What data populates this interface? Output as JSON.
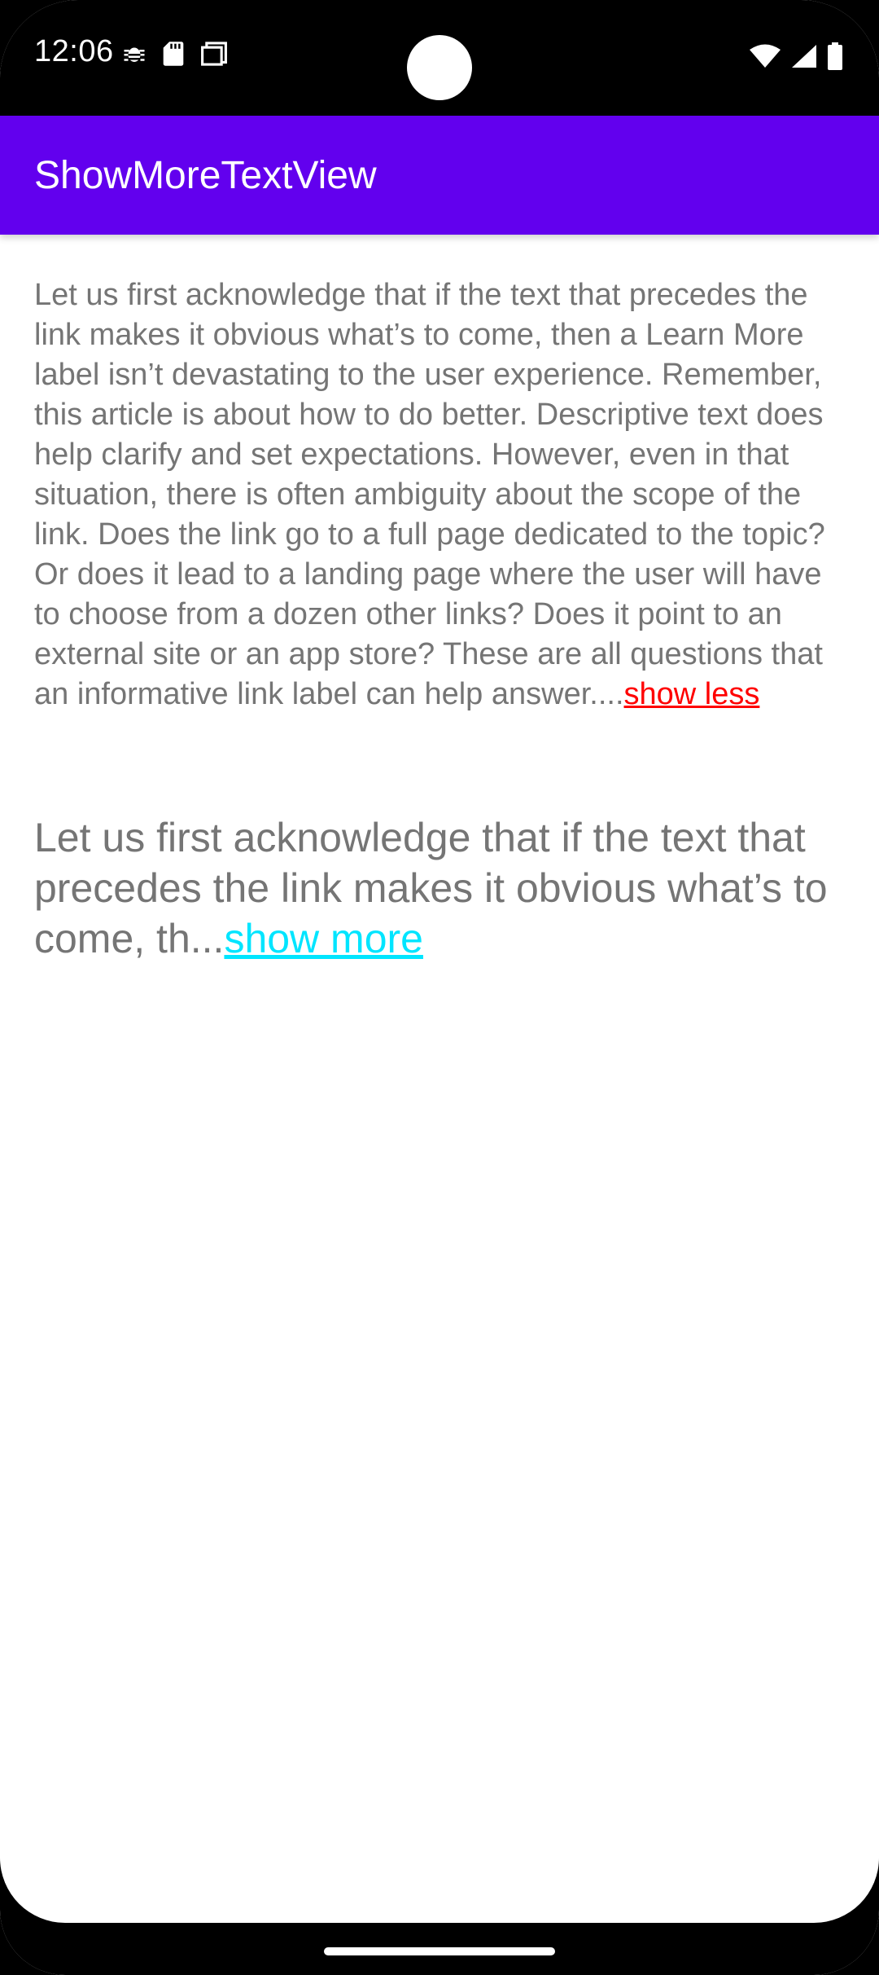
{
  "status_bar": {
    "time": "12:06",
    "left_icons": [
      "bug-icon",
      "sd-card-icon",
      "screenshot-icon"
    ],
    "right_icons": [
      "wifi-icon",
      "signal-icon",
      "battery-icon"
    ]
  },
  "app_bar": {
    "title": "ShowMoreTextView",
    "color": "#6200ee"
  },
  "content": {
    "expanded_text": "Let us first acknowledge that if the text that precedes the link makes it obvious what’s to come, then a Learn More label isn’t devastating to the user experience. Remember, this article is about how to do better. Descriptive text does help clarify and set expectations. However, even in that situation, there is often ambiguity about the scope of the link. Does the link go to a full page dedicated to the topic? Or does it lead to a landing page where the user will have to choose from a dozen other links? Does it point to an external site or an app store? These are all questions that an informative link label can help answer....",
    "show_less_label": "show less",
    "show_less_color": "#ff0000",
    "collapsed_text": "Let us first acknowledge that if the text that precedes the link makes it obvious what’s to come, th...",
    "show_more_label": "show more",
    "show_more_color": "#00e5ff",
    "text_color": "#757575"
  }
}
